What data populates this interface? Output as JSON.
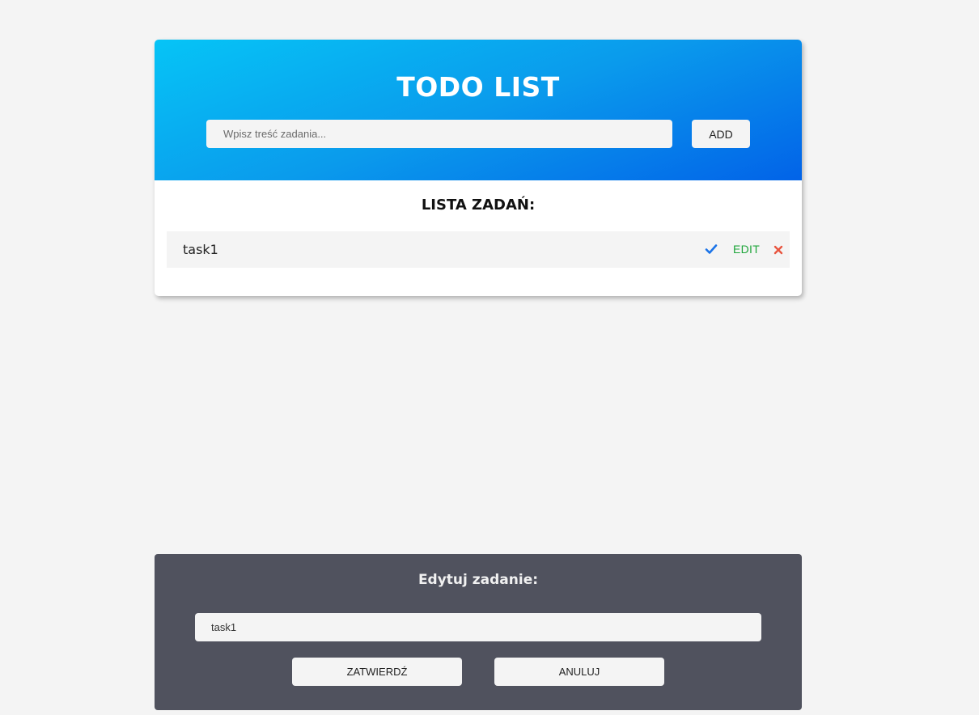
{
  "header": {
    "title": "TODO LIST",
    "input_placeholder": "Wpisz treść zadania...",
    "add_label": "ADD"
  },
  "list": {
    "title": "LISTA ZADAŃ:",
    "tasks": [
      {
        "text": "task1",
        "done_icon": "check-icon",
        "edit_label": "EDIT",
        "delete_icon": "close-icon"
      }
    ]
  },
  "edit_panel": {
    "title": "Edytuj zadanie:",
    "input_value": "task1",
    "confirm_label": "ZATWIERDŹ",
    "cancel_label": "ANULUJ"
  },
  "colors": {
    "header_gradient_start": "#06c4f6",
    "header_gradient_end": "#0263e8",
    "check": "#1a73e8",
    "edit": "#1ea53a",
    "delete": "#e8553f",
    "panel_background": "#50525e",
    "page_background": "#f4f4f4"
  }
}
